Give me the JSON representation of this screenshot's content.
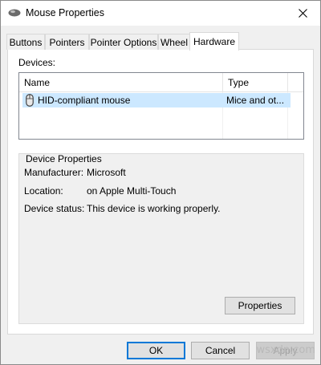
{
  "window": {
    "title": "Mouse Properties"
  },
  "tabs": [
    {
      "label": "Buttons"
    },
    {
      "label": "Pointers"
    },
    {
      "label": "Pointer Options"
    },
    {
      "label": "Wheel"
    },
    {
      "label": "Hardware",
      "active": true
    }
  ],
  "devices": {
    "label": "Devices:",
    "columns": [
      "Name",
      "Type"
    ],
    "rows": [
      {
        "name": "HID-compliant mouse",
        "type": "Mice and ot...",
        "selected": true,
        "icon": "mouse-icon"
      }
    ]
  },
  "device_properties": {
    "title": "Device Properties",
    "manufacturer_label": "Manufacturer:",
    "manufacturer_value": "Microsoft",
    "location_label": "Location:",
    "location_value": "on Apple Multi-Touch",
    "status_label": "Device status:",
    "status_value": "This device is working properly.",
    "properties_button": "Properties"
  },
  "buttons": {
    "ok": "OK",
    "cancel": "Cancel",
    "apply": "Apply"
  },
  "watermark": "wsxdn.com",
  "colors": {
    "selection": "#cce8ff",
    "accent": "#0078d7",
    "window_bg": "#f0f0f0"
  }
}
